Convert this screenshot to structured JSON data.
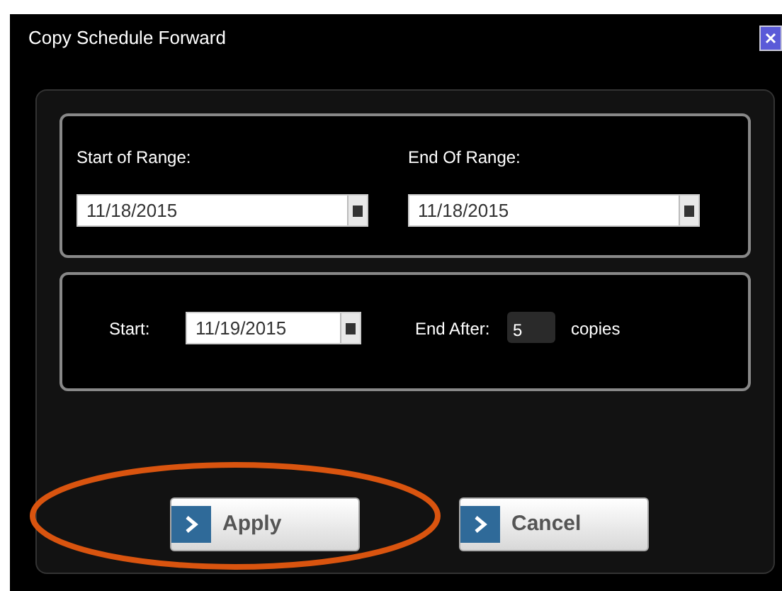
{
  "window": {
    "title": "Copy Schedule Forward"
  },
  "range": {
    "start": {
      "label": "Start of Range:",
      "value": "11/18/2015"
    },
    "end": {
      "label": "End Of Range:",
      "value": "11/18/2015"
    }
  },
  "repeat": {
    "start_label": "Start:",
    "start_value": "11/19/2015",
    "end_after_label": "End After:",
    "count": "5",
    "unit": "copies"
  },
  "buttons": [
    {
      "label": "Apply"
    },
    {
      "label": "Cancel"
    }
  ],
  "annotation": {
    "kind": "ellipse"
  }
}
